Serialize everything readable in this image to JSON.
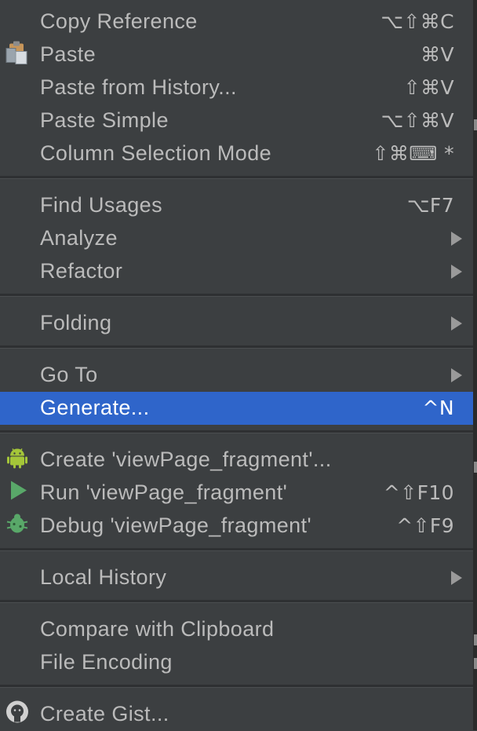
{
  "menu": {
    "items": [
      {
        "label": "Copy Reference",
        "shortcut": "⌥⇧⌘C"
      },
      {
        "label": "Paste",
        "shortcut": "⌘V",
        "icon": "clipboard-icon"
      },
      {
        "label": "Paste from History...",
        "shortcut": "⇧⌘V"
      },
      {
        "label": "Paste Simple",
        "shortcut": "⌥⇧⌘V"
      },
      {
        "label": "Column Selection Mode",
        "shortcut": "⇧⌘⌨ *"
      },
      {
        "label": "Find Usages",
        "shortcut": "⌥F7"
      },
      {
        "label": "Analyze",
        "submenu": true
      },
      {
        "label": "Refactor",
        "submenu": true
      },
      {
        "label": "Folding",
        "submenu": true
      },
      {
        "label": "Go To",
        "submenu": true
      },
      {
        "label": "Generate...",
        "shortcut": "^N",
        "active": true
      },
      {
        "label": "Create 'viewPage_fragment'...",
        "icon": "android-icon"
      },
      {
        "label": "Run 'viewPage_fragment'",
        "shortcut": "^⇧F10",
        "icon": "run-icon"
      },
      {
        "label": "Debug 'viewPage_fragment'",
        "shortcut": "^⇧F9",
        "icon": "debug-icon"
      },
      {
        "label": "Local History",
        "submenu": true
      },
      {
        "label": "Compare with Clipboard"
      },
      {
        "label": "File Encoding"
      },
      {
        "label": "Create Gist...",
        "icon": "github-icon"
      }
    ]
  },
  "colors": {
    "background": "#3c3f41",
    "selection": "#2f65ca",
    "text": "#bbbbbb",
    "separator": "#2e3032",
    "android_green": "#a4c639",
    "run_green": "#59a869"
  }
}
